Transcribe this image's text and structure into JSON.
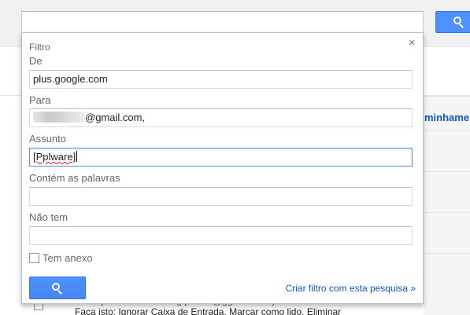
{
  "filter": {
    "title": "Filtro",
    "close_symbol": "×",
    "fields": {
      "from": {
        "label": "De",
        "value": "plus.google.com"
      },
      "to": {
        "label": "Para",
        "value_suffix": "@gmail.com,"
      },
      "subject": {
        "label": "Assunto",
        "value": "[Pplware]"
      },
      "has_words": {
        "label": "Contém as palavras",
        "value": ""
      },
      "doesnt_have": {
        "label": "Não tem",
        "value": ""
      }
    },
    "has_attachment": {
      "label": "Tem anexo",
      "checked": false
    },
    "search_button_icon": "search-icon",
    "create_filter_link": "Criar filtro com esta pesquisa »"
  },
  "background": {
    "right_partial_label": "minhame",
    "row1_text": "correspondências: from:(pplware@gg-mm.com)",
    "row2_prefix": "Faça isto:",
    "row2_actions": "Ignorar Caixa de Entrada, Marcar como lido, Eliminar"
  },
  "colors": {
    "accent_blue": "#4d90fe",
    "link_blue": "#1155cc"
  }
}
